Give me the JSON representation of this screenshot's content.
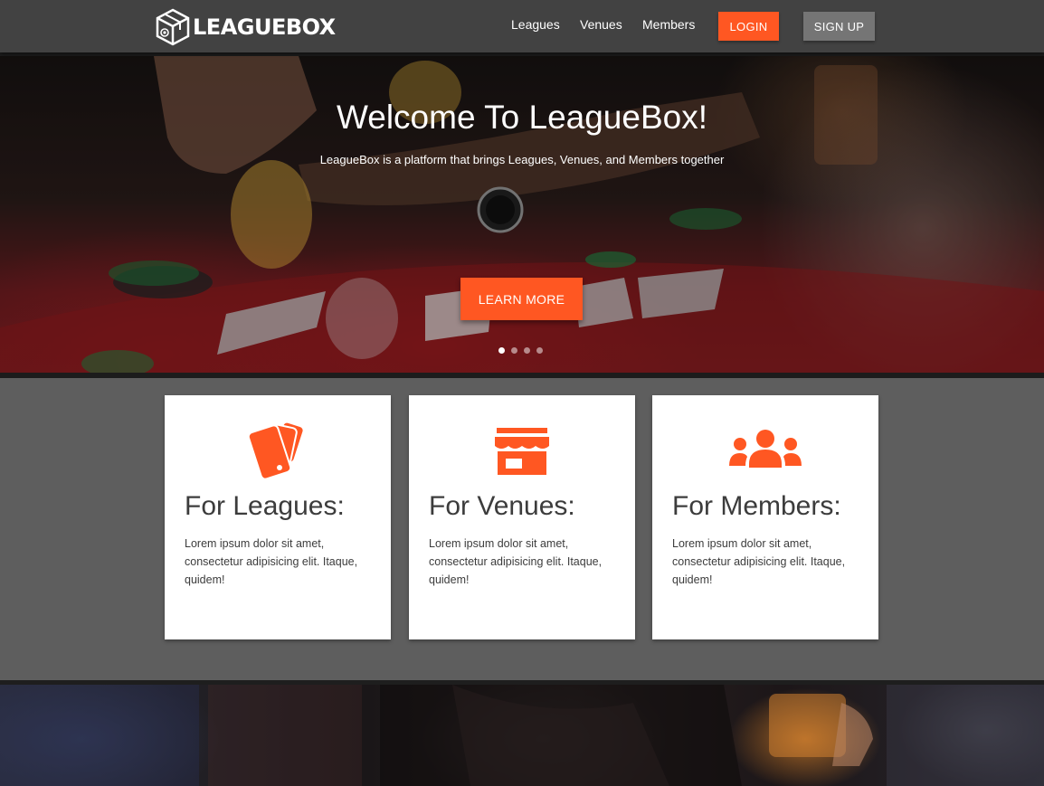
{
  "brand": {
    "name": "LEAGUEBOX"
  },
  "nav": {
    "links": [
      "Leagues",
      "Venues",
      "Members"
    ],
    "login_label": "LOGIN",
    "signup_label": "SIGN UP"
  },
  "hero": {
    "title": "Welcome To LeagueBox!",
    "subtitle": "LeagueBox is a platform that brings Leagues, Venues, and Members together",
    "cta_label": "LEARN MORE",
    "slides": 4,
    "active_slide": 1
  },
  "features": [
    {
      "icon": "cards-icon",
      "title": "For Leagues:",
      "text": "Lorem ipsum dolor sit amet, consectetur adipisicing elit. Itaque, quidem!"
    },
    {
      "icon": "store-icon",
      "title": "For Venues:",
      "text": "Lorem ipsum dolor sit amet, consectetur adipisicing elit. Itaque, quidem!"
    },
    {
      "icon": "group-icon",
      "title": "For Members:",
      "text": "Lorem ipsum dolor sit amet, consectetur adipisicing elit. Itaque, quidem!"
    }
  ],
  "colors": {
    "accent": "#ff5722",
    "nav_bg": "#424242",
    "page_bg": "#5e5e5e",
    "secondary_button": "#757575"
  }
}
